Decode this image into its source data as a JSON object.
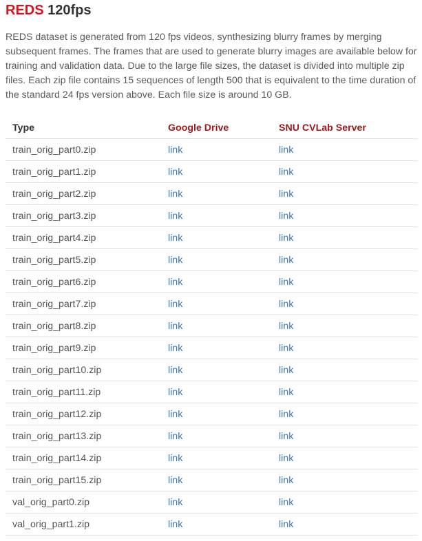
{
  "heading": {
    "accent": "REDS",
    "rest": "120fps"
  },
  "description": "REDS dataset is generated from 120 fps videos, synthesizing blurry frames by merging subsequent frames. The frames that are used to generate blurry images are available below for training and validation data. Due to the large file sizes, the dataset is divided into multiple zip files. Each zip file contains 15 sequences of length 500 that is equivalent to the time duration of the standard 24 fps version above. Each file size is around 10 GB.",
  "table": {
    "headers": {
      "type": "Type",
      "google_drive": "Google Drive",
      "snu_server": "SNU CVLab Server"
    },
    "link_label": "link",
    "rows": [
      {
        "file": "train_orig_part0.zip",
        "google_drive": "link",
        "snu_server": "link"
      },
      {
        "file": "train_orig_part1.zip",
        "google_drive": "link",
        "snu_server": "link"
      },
      {
        "file": "train_orig_part2.zip",
        "google_drive": "link",
        "snu_server": "link"
      },
      {
        "file": "train_orig_part3.zip",
        "google_drive": "link",
        "snu_server": "link"
      },
      {
        "file": "train_orig_part4.zip",
        "google_drive": "link",
        "snu_server": "link"
      },
      {
        "file": "train_orig_part5.zip",
        "google_drive": "link",
        "snu_server": "link"
      },
      {
        "file": "train_orig_part6.zip",
        "google_drive": "link",
        "snu_server": "link"
      },
      {
        "file": "train_orig_part7.zip",
        "google_drive": "link",
        "snu_server": "link"
      },
      {
        "file": "train_orig_part8.zip",
        "google_drive": "link",
        "snu_server": "link"
      },
      {
        "file": "train_orig_part9.zip",
        "google_drive": "link",
        "snu_server": "link"
      },
      {
        "file": "train_orig_part10.zip",
        "google_drive": "link",
        "snu_server": "link"
      },
      {
        "file": "train_orig_part11.zip",
        "google_drive": "link",
        "snu_server": "link"
      },
      {
        "file": "train_orig_part12.zip",
        "google_drive": "link",
        "snu_server": "link"
      },
      {
        "file": "train_orig_part13.zip",
        "google_drive": "link",
        "snu_server": "link"
      },
      {
        "file": "train_orig_part14.zip",
        "google_drive": "link",
        "snu_server": "link"
      },
      {
        "file": "train_orig_part15.zip",
        "google_drive": "link",
        "snu_server": "link"
      },
      {
        "file": "val_orig_part0.zip",
        "google_drive": "link",
        "snu_server": "link"
      },
      {
        "file": "val_orig_part1.zip",
        "google_drive": "link",
        "snu_server": "link"
      }
    ]
  },
  "colors": {
    "accent": "#d6141d",
    "header_text": "#a01a1a",
    "link": "#3a7ab3",
    "body_text": "#555555",
    "divider": "#dddddd"
  }
}
